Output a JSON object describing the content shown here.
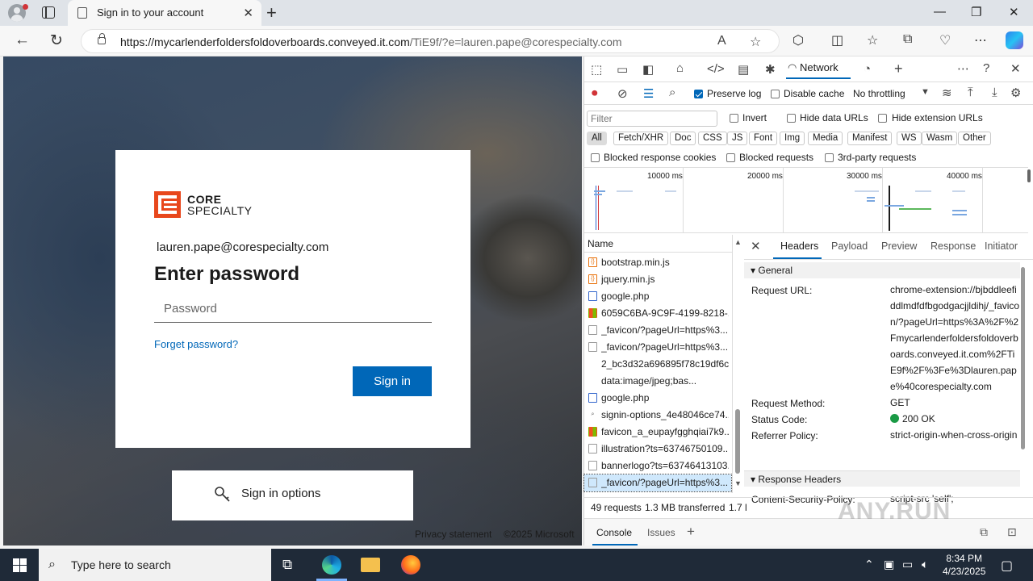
{
  "browser": {
    "tab_title": "Sign in to your account",
    "url_host": "https://mycarlenderfoldersfoldoverboards.conveyed.it.com",
    "url_path": "/TiE9f/?e=lauren.pape@corespecialty.com"
  },
  "page": {
    "logo_line1": "CORE",
    "logo_line2": "SPECIALTY",
    "email": "lauren.pape@corespecialty.com",
    "heading": "Enter password",
    "password_placeholder": "Password",
    "forgot_link": "Forget password?",
    "signin_button": "Sign in",
    "signin_options": "Sign in options",
    "footer_privacy": "Privacy statement",
    "footer_copyright": "©2025 Microsoft"
  },
  "devtools": {
    "active_tab": "Network",
    "preserve_log": "Preserve log",
    "disable_cache": "Disable cache",
    "throttling": "No throttling",
    "filter_placeholder": "Filter",
    "invert": "Invert",
    "hide_data_urls": "Hide data URLs",
    "hide_extension_urls": "Hide extension URLs",
    "type_filters": [
      "All",
      "Fetch/XHR",
      "Doc",
      "CSS",
      "JS",
      "Font",
      "Img",
      "Media",
      "Manifest",
      "WS",
      "Wasm",
      "Other"
    ],
    "blocked_response_cookies": "Blocked response cookies",
    "blocked_requests": "Blocked requests",
    "third_party_requests": "3rd-party requests",
    "timeline_labels": [
      "10000 ms",
      "20000 ms",
      "30000 ms",
      "40000 ms"
    ],
    "name_header": "Name",
    "requests": [
      {
        "name": "bootstrap.min.js",
        "type": "js"
      },
      {
        "name": "jquery.min.js",
        "type": "js"
      },
      {
        "name": "google.php",
        "type": "doc"
      },
      {
        "name": "6059C6BA-9C9F-4199-8218-...",
        "type": "img-ms"
      },
      {
        "name": "_favicon/?pageUrl=https%3...",
        "type": "img"
      },
      {
        "name": "_favicon/?pageUrl=https%3...",
        "type": "img"
      },
      {
        "name": "2_bc3d32a696895f78c19df6c...",
        "type": "blank"
      },
      {
        "name": "data:image/jpeg;bas...",
        "type": "blank"
      },
      {
        "name": "google.php",
        "type": "doc"
      },
      {
        "name": "signin-options_4e48046ce74...",
        "type": "svg"
      },
      {
        "name": "favicon_a_eupayfgghqiai7k9...",
        "type": "img-ms"
      },
      {
        "name": "illustration?ts=63746750109...",
        "type": "img"
      },
      {
        "name": "bannerlogo?ts=63746413103...",
        "type": "img"
      },
      {
        "name": "_favicon/?pageUrl=https%3...",
        "type": "img"
      }
    ],
    "detail_tabs": [
      "Headers",
      "Payload",
      "Preview",
      "Response",
      "Initiator"
    ],
    "general_section": "General",
    "request_url_key": "Request URL:",
    "request_url_value": "chrome-extension://bjbddleefiddlmdfdfbgodgacjjldihj/_favicon/?pageUrl=https%3A%2F%2Fmycarlenderfoldersfoldoverboards.conveyed.it.com%2FTiE9f%2F%3Fe%3Dlauren.pape%40corespecialty.com",
    "request_method_key": "Request Method:",
    "request_method_value": "GET",
    "status_code_key": "Status Code:",
    "status_code_value": "200 OK",
    "referrer_policy_key": "Referrer Policy:",
    "referrer_policy_value": "strict-origin-when-cross-origin",
    "response_headers_section": "Response Headers",
    "csp_key": "Content-Security-Policy:",
    "csp_value": "script-src 'self';",
    "status_requests": "49 requests",
    "status_transferred": "1.3 MB transferred",
    "status_more": "1.7 l",
    "drawer_console": "Console",
    "drawer_issues": "Issues"
  },
  "watermark": "ANY.RUN",
  "taskbar": {
    "search_placeholder": "Type here to search",
    "time": "8:34 PM",
    "date": "4/23/2025"
  }
}
